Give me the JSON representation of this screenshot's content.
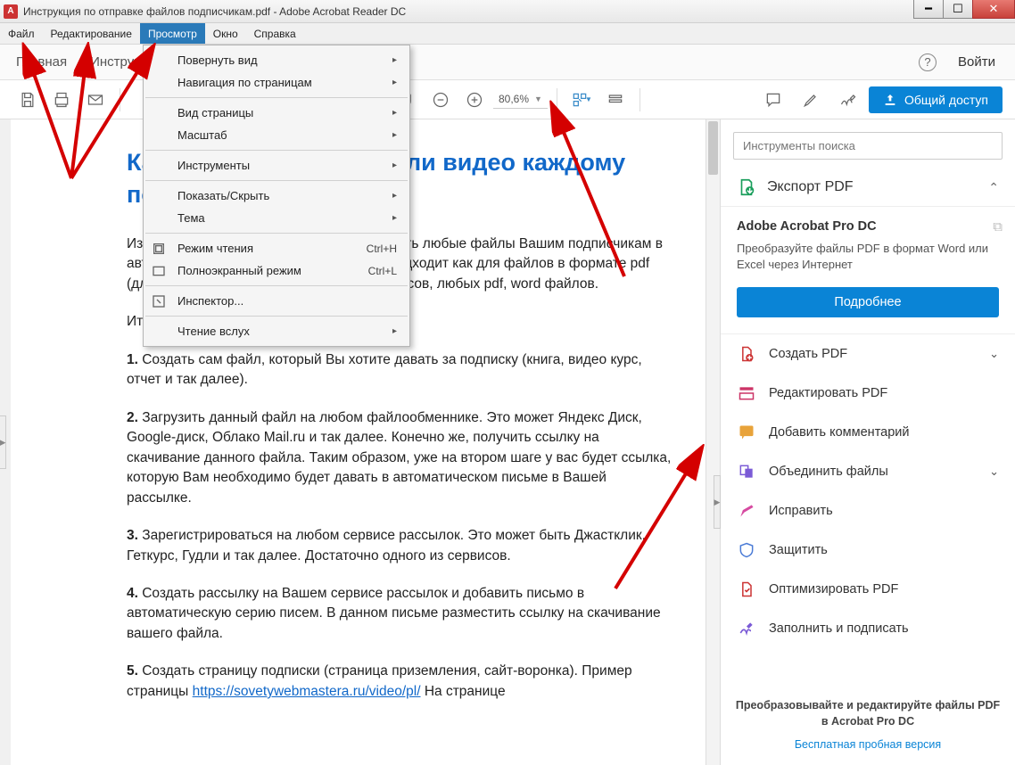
{
  "titlebar": {
    "title": "Инструкция по отправке файлов подписчикам.pdf - Adobe Acrobat Reader DC"
  },
  "menubar": {
    "items": [
      "Файл",
      "Редактирование",
      "Просмотр",
      "Окно",
      "Справка"
    ],
    "active_index": 2
  },
  "tabbar": {
    "tabs": [
      "Главная",
      "Инструменты"
    ],
    "login": "Войти"
  },
  "toolbar": {
    "zoom": "80,6%",
    "share": "Общий доступ"
  },
  "dropdown": {
    "items": [
      {
        "label": "Повернуть вид",
        "sub": true
      },
      {
        "label": "Навигация по страницам",
        "sub": true
      },
      {
        "sep": true
      },
      {
        "label": "Вид страницы",
        "sub": true
      },
      {
        "label": "Масштаб",
        "sub": true
      },
      {
        "sep": true
      },
      {
        "label": "Инструменты",
        "sub": true
      },
      {
        "sep": true
      },
      {
        "label": "Показать/Скрыть",
        "sub": true
      },
      {
        "label": "Тема",
        "sub": true
      },
      {
        "sep": true
      },
      {
        "label": "Режим чтения",
        "shortcut": "Ctrl+H",
        "icon": "reading"
      },
      {
        "label": "Полноэкранный режим",
        "shortcut": "Ctrl+L",
        "icon": "fullscreen"
      },
      {
        "sep": true
      },
      {
        "label": "Инспектор...",
        "icon": "inspector"
      },
      {
        "sep": true
      },
      {
        "label": "Чтение вслух",
        "sub": true
      }
    ]
  },
  "document": {
    "title": "Как отправлять книгу или видео каждому подписчику.",
    "p1": "Из данного урока Вы узнаете, как отправлять любые файлы Вашим подписчикам в автоматическом режиме. То есть, схема подходит как для файлов в формате pdf (для книг), для видео курсов, для аудио курсов, любых pdf, word файлов.",
    "p2": "Итак, давайте все разберем по шагам.",
    "s1": "Создать сам файл, который Вы хотите давать за подписку (книга, видео курс, отчет и так далее).",
    "s2": "Загрузить данный файл на любом файлообменнике. Это может Яндекс Диск, Google-диск, Облако Mail.ru и так далее. Конечно же, получить ссылку на скачивание данного файла. Таким образом, уже на втором шаге у вас будет ссылка, которую Вам необходимо будет давать в автоматическом письме в Вашей рассылке.",
    "s3": "Зарегистрироваться на любом сервисе рассылок. Это может быть Джастклик, Геткурс, Гудли и так далее. Достаточно одного из сервисов.",
    "s4": "Создать рассылку на Вашем сервисе рассылок и добавить письмо в автоматическую серию писем. В данном письме разместить ссылку на скачивание вашего файла.",
    "s5a": "Создать страницу подписки (страница приземления, сайт-воронка). Пример страницы ",
    "s5link": "https://sovetywebmastera.ru/video/pl/",
    "s5b": " На странице"
  },
  "sidebar": {
    "search_placeholder": "Инструменты поиска",
    "export": {
      "title": "Экспорт PDF",
      "subtitle": "Adobe Acrobat Pro DC",
      "desc": "Преобразуйте файлы PDF в формат Word или Excel через Интернет",
      "btn": "Подробнее"
    },
    "tools": [
      {
        "label": "Создать PDF",
        "chev": true,
        "color": "#c33"
      },
      {
        "label": "Редактировать PDF",
        "color": "#c36"
      },
      {
        "label": "Добавить комментарий",
        "color": "#e8a33a"
      },
      {
        "label": "Объединить файлы",
        "chev": true,
        "color": "#7b5bd6"
      },
      {
        "label": "Исправить",
        "color": "#d64aa1"
      },
      {
        "label": "Защитить",
        "color": "#4a7bd6"
      },
      {
        "label": "Оптимизировать PDF",
        "color": "#c33"
      },
      {
        "label": "Заполнить и подписать",
        "color": "#7b5bd6"
      }
    ],
    "footer1": "Преобразовывайте и редактируйте файлы PDF в Acrobat Pro DC",
    "footer2": "Бесплатная пробная версия"
  }
}
